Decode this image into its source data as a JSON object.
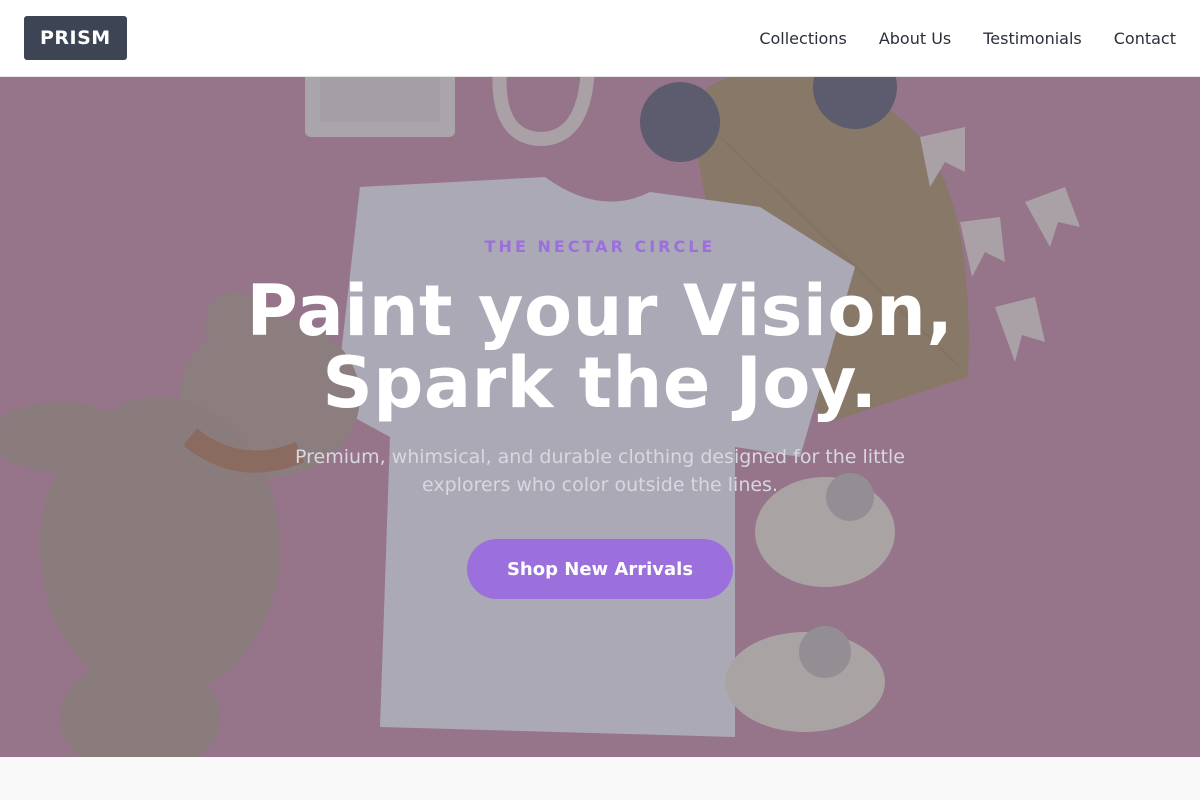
{
  "brand": {
    "logo_text": "PRISM"
  },
  "nav": {
    "items": [
      {
        "label": "Collections"
      },
      {
        "label": "About Us"
      },
      {
        "label": "Testimonials"
      },
      {
        "label": "Contact"
      }
    ]
  },
  "hero": {
    "eyebrow": "THE NECTAR CIRCLE",
    "headline_line1": "Paint your Vision,",
    "headline_line2": "Spark the Joy.",
    "subtext": "Premium, whimsical, and durable clothing designed for the little explorers who color outside the lines.",
    "cta_label": "Shop New Arrivals"
  },
  "colors": {
    "accent": "#9b6fdc",
    "logo_bg": "#3d4454",
    "hero_background": "#c98fa3"
  }
}
